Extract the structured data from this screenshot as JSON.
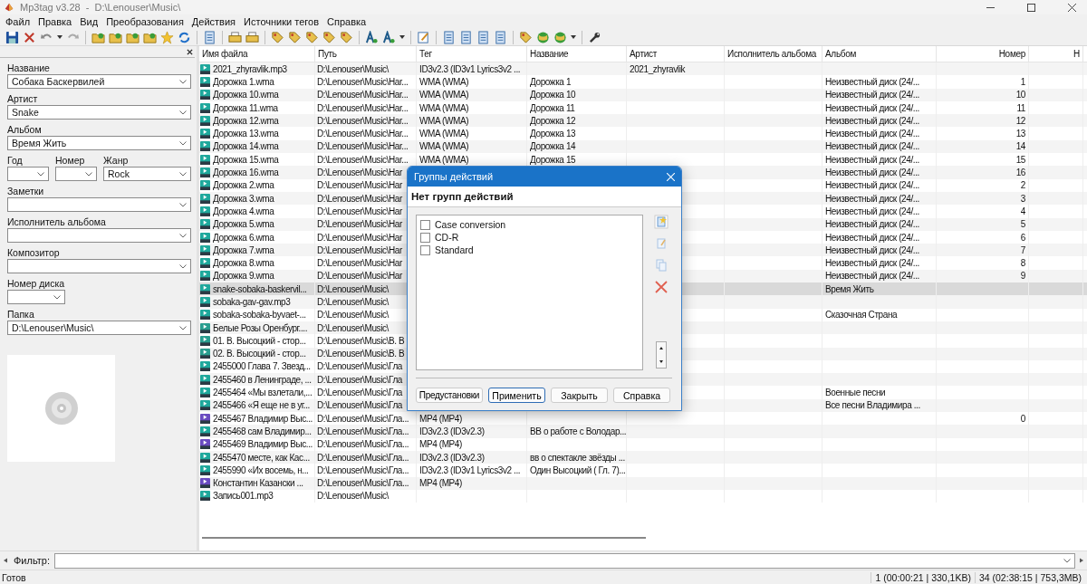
{
  "window": {
    "title": "Mp3tag v3.28  -  D:\\Lenouser\\Music\\"
  },
  "menu": [
    "Файл",
    "Правка",
    "Вид",
    "Преобразования",
    "Действия",
    "Источники тегов",
    "Справка"
  ],
  "tag_panel": {
    "rows": [
      [
        {
          "label": "Название",
          "value": "Собака Баскервилей",
          "kind": "wide"
        }
      ],
      [
        {
          "label": "Артист",
          "value": "Snake",
          "kind": "wide"
        }
      ],
      [
        {
          "label": "Альбом",
          "value": "Время Жить",
          "kind": "wide"
        }
      ],
      [
        {
          "label": "Год",
          "kind": "short"
        },
        {
          "label": "Номер",
          "kind": "short"
        },
        {
          "label": "Жанр",
          "value": "Rock",
          "kind": "wide"
        }
      ],
      [
        {
          "label": "Заметки",
          "kind": "wide"
        }
      ],
      [
        {
          "label": "Исполнитель альбома",
          "kind": "wide"
        }
      ],
      [
        {
          "label": "Композитор",
          "kind": "wide"
        }
      ],
      [
        {
          "label": "Номер диска",
          "kind": "short"
        }
      ],
      [
        {
          "label": "Папка",
          "value": "D:\\Lenouser\\Music\\",
          "kind": "wide"
        }
      ]
    ],
    "cover": {
      "kind": "picture"
    }
  },
  "table": {
    "columns": [
      "Имя файла",
      "Путь",
      "Тег",
      "Название",
      "Артист",
      "Исполнитель альбома",
      "Альбом",
      "Номер",
      "Н"
    ],
    "rows": [
      {
        "kind": "mp3",
        "selected": false,
        "file": "2021_zhyravlik.mp3",
        "path": "D:\\Lenouser\\Music\\",
        "tag": "ID3v2.3 (ID3v1 Lyrics3v2 ...",
        "artist": "2021_zhyravlik"
      },
      {
        "kind": "wma",
        "selected": false,
        "file": "Дорожка 1.wma",
        "path": "D:\\Lenouser\\Music\\Har...",
        "tag": "WMA (WMA)",
        "title": "Дорожка 1",
        "album": "Неизвестный диск (24/...",
        "track": "1"
      },
      {
        "kind": "wma",
        "selected": false,
        "file": "Дорожка 10.wma",
        "path": "D:\\Lenouser\\Music\\Har...",
        "tag": "WMA (WMA)",
        "title": "Дорожка 10",
        "album": "Неизвестный диск (24/...",
        "track": "10"
      },
      {
        "kind": "wma",
        "selected": false,
        "file": "Дорожка 11.wma",
        "path": "D:\\Lenouser\\Music\\Har...",
        "tag": "WMA (WMA)",
        "title": "Дорожка 11",
        "album": "Неизвестный диск (24/...",
        "track": "11"
      },
      {
        "kind": "wma",
        "selected": false,
        "file": "Дорожка 12.wma",
        "path": "D:\\Lenouser\\Music\\Har...",
        "tag": "WMA (WMA)",
        "title": "Дорожка 12",
        "album": "Неизвестный диск (24/...",
        "track": "12"
      },
      {
        "kind": "wma",
        "selected": false,
        "file": "Дорожка 13.wma",
        "path": "D:\\Lenouser\\Music\\Har...",
        "tag": "WMA (WMA)",
        "title": "Дорожка 13",
        "album": "Неизвестный диск (24/...",
        "track": "13"
      },
      {
        "kind": "wma",
        "selected": false,
        "file": "Дорожка 14.wma",
        "path": "D:\\Lenouser\\Music\\Har...",
        "tag": "WMA (WMA)",
        "title": "Дорожка 14",
        "album": "Неизвестный диск (24/...",
        "track": "14"
      },
      {
        "kind": "wma",
        "selected": false,
        "file": "Дорожка 15.wma",
        "path": "D:\\Lenouser\\Music\\Har...",
        "tag": "WMA (WMA)",
        "title": "Дорожка 15",
        "album": "Неизвестный диск (24/...",
        "track": "15"
      },
      {
        "kind": "wma",
        "selected": false,
        "file": "Дорожка 16.wma",
        "path": "D:\\Lenouser\\Music\\Har",
        "album": "Неизвестный диск (24/...",
        "track": "16"
      },
      {
        "kind": "wma",
        "selected": false,
        "file": "Дорожка 2.wma",
        "path": "D:\\Lenouser\\Music\\Har",
        "album": "Неизвестный диск (24/...",
        "track": "2"
      },
      {
        "kind": "wma",
        "selected": false,
        "file": "Дорожка 3.wma",
        "path": "D:\\Lenouser\\Music\\Har",
        "album": "Неизвестный диск (24/...",
        "track": "3"
      },
      {
        "kind": "wma",
        "selected": false,
        "file": "Дорожка 4.wma",
        "path": "D:\\Lenouser\\Music\\Har",
        "album": "Неизвестный диск (24/...",
        "track": "4"
      },
      {
        "kind": "wma",
        "selected": false,
        "file": "Дорожка 5.wma",
        "path": "D:\\Lenouser\\Music\\Har",
        "album": "Неизвестный диск (24/...",
        "track": "5"
      },
      {
        "kind": "wma",
        "selected": false,
        "file": "Дорожка 6.wma",
        "path": "D:\\Lenouser\\Music\\Har",
        "album": "Неизвестный диск (24/...",
        "track": "6"
      },
      {
        "kind": "wma",
        "selected": false,
        "file": "Дорожка 7.wma",
        "path": "D:\\Lenouser\\Music\\Har",
        "album": "Неизвестный диск (24/...",
        "track": "7"
      },
      {
        "kind": "wma",
        "selected": false,
        "file": "Дорожка 8.wma",
        "path": "D:\\Lenouser\\Music\\Har",
        "album": "Неизвестный диск (24/...",
        "track": "8"
      },
      {
        "kind": "wma",
        "selected": false,
        "file": "Дорожка 9.wma",
        "path": "D:\\Lenouser\\Music\\Har",
        "album": "Неизвестный диск (24/...",
        "track": "9"
      },
      {
        "kind": "mp3",
        "selected": true,
        "file": "snake-sobaka-baskervil...",
        "path": "D:\\Lenouser\\Music\\",
        "album": "Время Жить"
      },
      {
        "kind": "mp3",
        "selected": false,
        "file": "sobaka-gav-gav.mp3",
        "path": "D:\\Lenouser\\Music\\"
      },
      {
        "kind": "mp3",
        "selected": false,
        "file": "sobaka-sobaka-byvaet-...",
        "path": "D:\\Lenouser\\Music\\",
        "album": "Сказочная Страна"
      },
      {
        "kind": "flac",
        "selected": false,
        "file": "Белые Розы Оренбург....",
        "path": "D:\\Lenouser\\Music\\"
      },
      {
        "kind": "flac",
        "selected": false,
        "file": "01. В. Высоцкий - стор...",
        "path": "D:\\Lenouser\\Music\\В. В"
      },
      {
        "kind": "flac",
        "selected": false,
        "file": "02. В. Высоцкий - стор...",
        "path": "D:\\Lenouser\\Music\\В. В"
      },
      {
        "kind": "mp3",
        "selected": false,
        "file": "2455000 Глава 7. Звезд...",
        "path": "D:\\Lenouser\\Music\\Гла"
      },
      {
        "kind": "mp3",
        "selected": false,
        "file": "2455460 в Ленинграде, ...",
        "path": "D:\\Lenouser\\Music\\Гла"
      },
      {
        "kind": "mp3",
        "selected": false,
        "file": "2455464 «Мы взлетали,...",
        "path": "D:\\Lenouser\\Music\\Гла",
        "album": "Военные песни"
      },
      {
        "kind": "mp3",
        "selected": false,
        "file": "2455466 «Я еще не в уг...",
        "path": "D:\\Lenouser\\Music\\Гла",
        "album": "Все песни Владимира ..."
      },
      {
        "kind": "mp4",
        "selected": false,
        "file": "2455467 Владимир Выс...",
        "path": "D:\\Lenouser\\Music\\Гла...",
        "tag": "MP4 (MP4)",
        "track": "0"
      },
      {
        "kind": "mp3",
        "selected": false,
        "file": "2455468 сам Владимир...",
        "path": "D:\\Lenouser\\Music\\Гла...",
        "tag": "ID3v2.3 (ID3v2.3)",
        "title": "ВВ о работе с Володар..."
      },
      {
        "kind": "mp4",
        "selected": false,
        "file": "2455469 Владимир Выс...",
        "path": "D:\\Lenouser\\Music\\Гла...",
        "tag": "MP4 (MP4)"
      },
      {
        "kind": "mp3",
        "selected": false,
        "file": "2455470 месте, как Кас...",
        "path": "D:\\Lenouser\\Music\\Гла...",
        "tag": "ID3v2.3 (ID3v2.3)",
        "title": "вв о спектакле звёзды ..."
      },
      {
        "kind": "mp3",
        "selected": false,
        "file": "2455990 «Их восемь, н...",
        "path": "D:\\Lenouser\\Music\\Гла...",
        "tag": "ID3v2.3 (ID3v1 Lyrics3v2 ...",
        "title": "Один Высоцкий ( Гл. 7)..."
      },
      {
        "kind": "mp4",
        "selected": false,
        "file": "Константин Казански ...",
        "path": "D:\\Lenouser\\Music\\Гла...",
        "tag": "MP4 (MP4)"
      },
      {
        "kind": "mp3",
        "selected": false,
        "file": "Запись001.mp3",
        "path": "D:\\Lenouser\\Music\\"
      }
    ]
  },
  "filter": {
    "label": "Фильтр:"
  },
  "status_bar": {
    "text": "Готов",
    "selection": "1 (00:00:21 | 330,1KB)",
    "total": "34 (02:38:15 | 753,3MB)"
  },
  "dialog": {
    "title": "Группы действий",
    "heading": "Нет групп действий",
    "items": [
      {
        "label": "Case conversion",
        "checked": false
      },
      {
        "label": "CD-R",
        "checked": false
      },
      {
        "label": "Standard",
        "checked": false
      }
    ],
    "buttons": [
      {
        "label": "Предустановки",
        "default": false
      },
      {
        "label": "Применить",
        "default": true
      },
      {
        "label": "Закрыть",
        "default": false
      },
      {
        "label": "Справка",
        "default": false
      }
    ]
  }
}
